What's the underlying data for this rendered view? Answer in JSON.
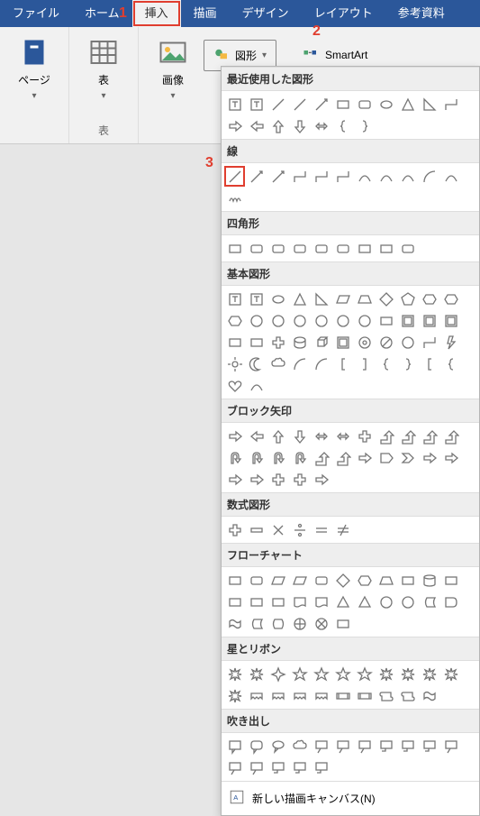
{
  "tabs": {
    "file": "ファイル",
    "home": "ホーム",
    "insert": "挿入",
    "draw": "描画",
    "design": "デザイン",
    "layout": "レイアウト",
    "ref": "参考資料"
  },
  "ribbon": {
    "page": "ページ",
    "table": "表",
    "tableGroup": "表",
    "image": "画像",
    "shapes": "図形",
    "smartart": "SmartArt"
  },
  "sections": {
    "recent": "最近使用した図形",
    "lines": "線",
    "rects": "四角形",
    "basic": "基本図形",
    "blockArrows": "ブロック矢印",
    "equation": "数式図形",
    "flowchart": "フローチャート",
    "stars": "星とリボン",
    "callouts": "吹き出し"
  },
  "footer": {
    "newCanvas": "新しい描画キャンバス(N)"
  },
  "annotations": {
    "a1": "1",
    "a2": "2",
    "a3": "3"
  }
}
